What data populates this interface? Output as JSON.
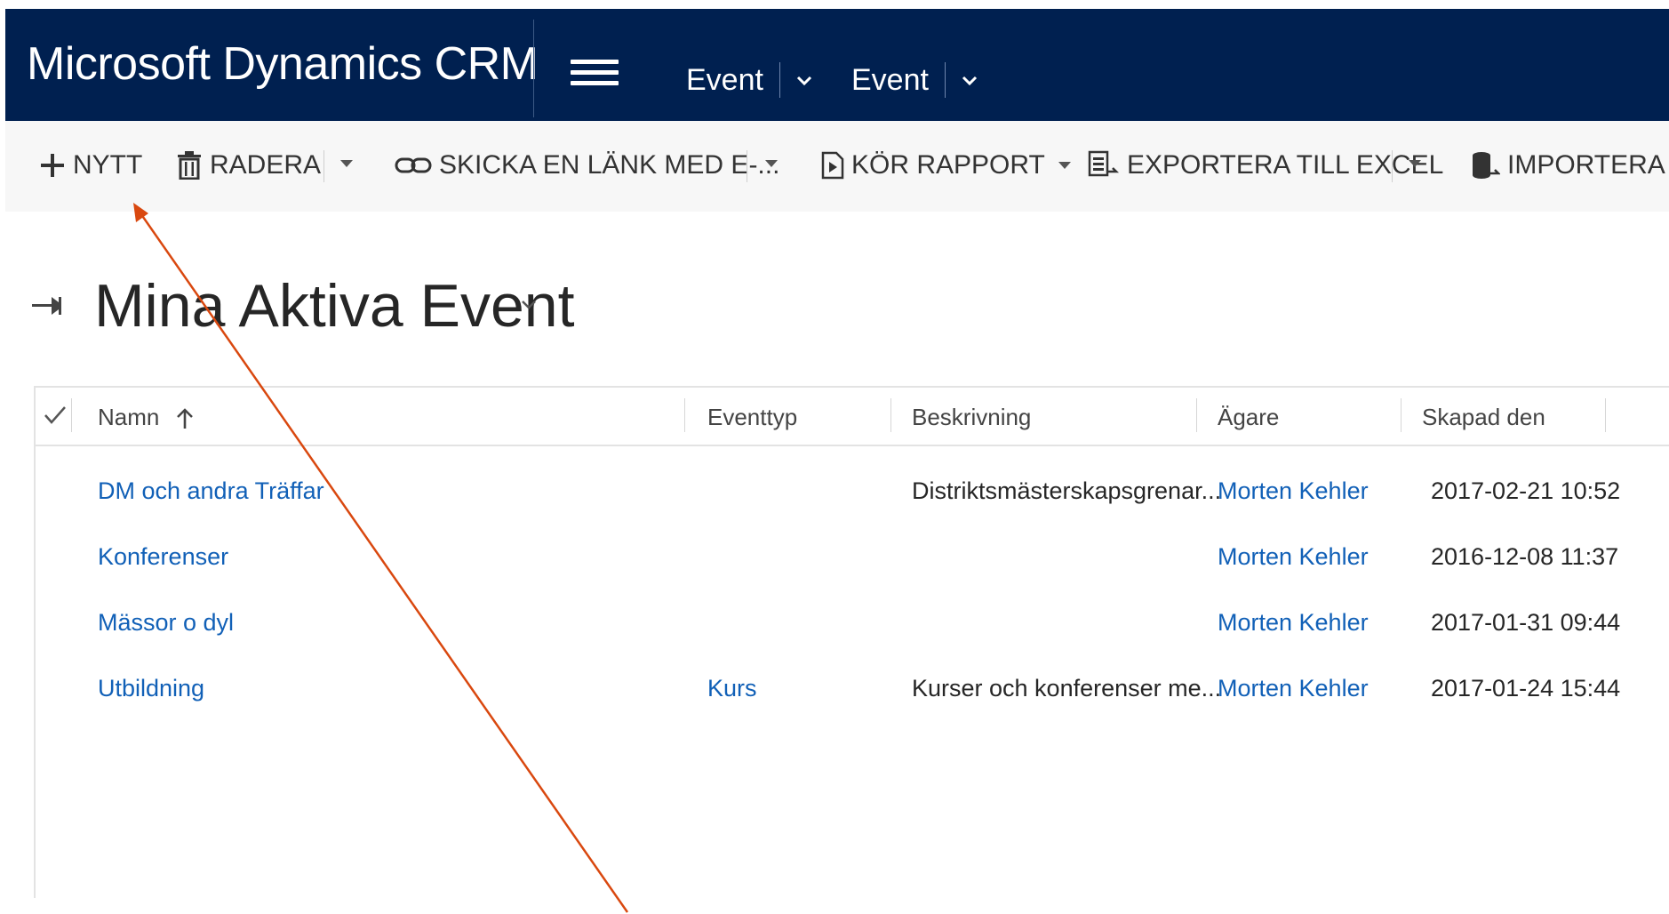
{
  "header": {
    "app_title": "Microsoft Dynamics CRM",
    "nav": [
      {
        "label": "Event"
      },
      {
        "label": "Event"
      }
    ]
  },
  "commands": {
    "new": "NYTT",
    "delete": "RADERA",
    "email_link": "SKICKA EN LÄNK MED E-...",
    "run_report": "KÖR RAPPORT",
    "export_excel": "EXPORTERA TILL EXCEL",
    "import": "IMPORTERA DA"
  },
  "view": {
    "title": "Mina Aktiva Event"
  },
  "grid": {
    "columns": [
      "Namn",
      "Eventtyp",
      "Beskrivning",
      "Ägare",
      "Skapad den"
    ],
    "rows": [
      {
        "name": "DM och andra Träffar",
        "type": "",
        "description": "Distriktsmästerskapsgrenar...",
        "owner": "Morten Kehler",
        "created": "2017-02-21 10:52"
      },
      {
        "name": "Konferenser",
        "type": "",
        "description": "",
        "owner": "Morten Kehler",
        "created": "2016-12-08 11:37"
      },
      {
        "name": "Mässor o dyl",
        "type": "",
        "description": "",
        "owner": "Morten Kehler",
        "created": "2017-01-31 09:44"
      },
      {
        "name": "Utbildning",
        "type": "Kurs",
        "description": "Kurser och konferenser me...",
        "owner": "Morten Kehler",
        "created": "2017-01-24 15:44"
      }
    ]
  },
  "colors": {
    "nav_bg": "#002050",
    "command_bg": "#f7f7f7",
    "link": "#1160b7",
    "annotation_arrow": "#d9480f"
  }
}
